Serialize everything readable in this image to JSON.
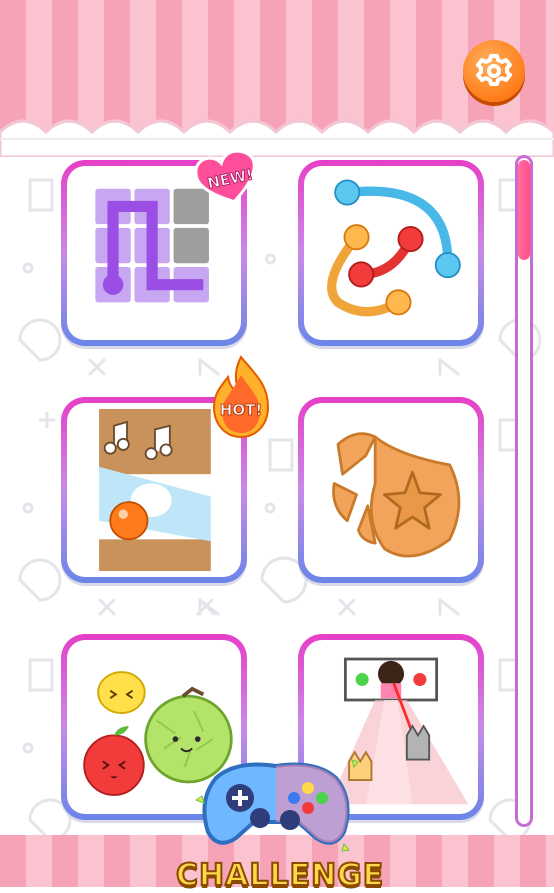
{
  "header": {
    "settings_icon": "gear-icon",
    "accent": "#ff7d1a"
  },
  "badges": {
    "new": "NEW!",
    "hot": "HOT!"
  },
  "games": [
    {
      "id": "line-puzzle",
      "icon": "grid-path-icon"
    },
    {
      "id": "connect-balls",
      "icon": "rope-balls-icon"
    },
    {
      "id": "music-ball-drop",
      "icon": "music-ball-icon"
    },
    {
      "id": "cookie-star",
      "icon": "cookie-star-icon"
    },
    {
      "id": "fruit-merge",
      "icon": "fruit-icon"
    },
    {
      "id": "red-light",
      "icon": "red-light-icon"
    }
  ],
  "challenge": {
    "label": "CHALLENGE",
    "icon": "gamepad-icon"
  },
  "colors": {
    "tile_border_top": "#e63fc7",
    "tile_border_bottom": "#6a86e8",
    "stripe_a": "#f7a3b7",
    "stripe_b": "#fbc3d0"
  }
}
